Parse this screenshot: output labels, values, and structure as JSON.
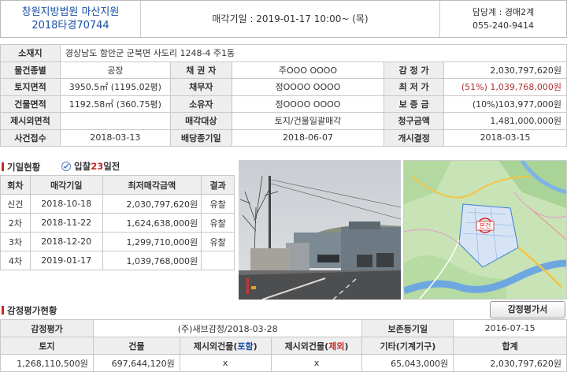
{
  "header": {
    "court": "창원지방법원 마산지원",
    "case_no": "2018타경70744",
    "auction_date": "매각기일 : 2019-01-17   10:00~ (목)",
    "dept": "담당계 : 경매2계",
    "phone": "055-240-9414"
  },
  "info": {
    "address_label": "소재지",
    "address": "경상남도 함안군 군북면 사도리 1248-4 주1동",
    "type_label": "물건종별",
    "type": "공장",
    "creditor_label": "채 권 자",
    "creditor": "주OOO OOOO",
    "appraisal_label": "감 정 가",
    "appraisal": "2,030,797,620원",
    "land_label": "토지면적",
    "land": "3950.5㎡ (1195.02평)",
    "debtor_label": "채무자",
    "debtor": "정OOOO OOOO",
    "minprice_label": "최 저 가",
    "minprice": "(51%) 1,039,768,000원",
    "bldg_label": "건물면적",
    "bldg": "1192.58㎡ (360.75평)",
    "owner_label": "소유자",
    "owner": "정OOOO OOOO",
    "deposit_label": "보 증 금",
    "deposit": "(10%)103,977,000원",
    "excl_label": "제시외면적",
    "excl": "",
    "target_label": "매각대상",
    "target": "토지/건물일괄매각",
    "claim_label": "청구금액",
    "claim": "1,481,000,000원",
    "receipt_label": "사건접수",
    "receipt": "2018-03-13",
    "dividend_label": "배당종기일",
    "dividend": "2018-06-07",
    "start_label": "개시결정",
    "start": "2018-03-15"
  },
  "history": {
    "title": "기일현황",
    "link_prefix": "입찰",
    "link_days": "23",
    "link_suffix": "일전",
    "headers": [
      "회차",
      "매각기일",
      "최저매각금액",
      "결과"
    ],
    "rows": [
      [
        "신건",
        "2018-10-18",
        "2,030,797,620원",
        "유찰"
      ],
      [
        "2차",
        "2018-11-22",
        "1,624,638,000원",
        "유찰"
      ],
      [
        "3차",
        "2018-12-20",
        "1,299,710,000원",
        "유찰"
      ],
      [
        "4차",
        "2019-01-17",
        "1,039,768,000원",
        ""
      ]
    ]
  },
  "map": {
    "marker": "본건"
  },
  "appraisal_section": {
    "title": "감정평가현황",
    "button": "감정평가서",
    "row1": {
      "label": "감정평가",
      "value": "(주)새브감정/2018-03-28",
      "label2": "보존등기일",
      "value2": "2016-07-15"
    },
    "headers": {
      "land": "토지",
      "bldg": "건물",
      "excl_in_pre": "제시외건물(",
      "excl_in_tag": "포함",
      "excl_out_pre": "제시외건물(",
      "excl_out_tag": "제외",
      "close": ")",
      "etc": "기타(기계기구)",
      "total": "합계"
    },
    "values": {
      "land": "1,268,110,500원",
      "bldg": "697,644,120원",
      "excl_in": "x",
      "excl_out": "x",
      "etc": "65,043,000원",
      "total": "2,030,797,620원"
    }
  }
}
